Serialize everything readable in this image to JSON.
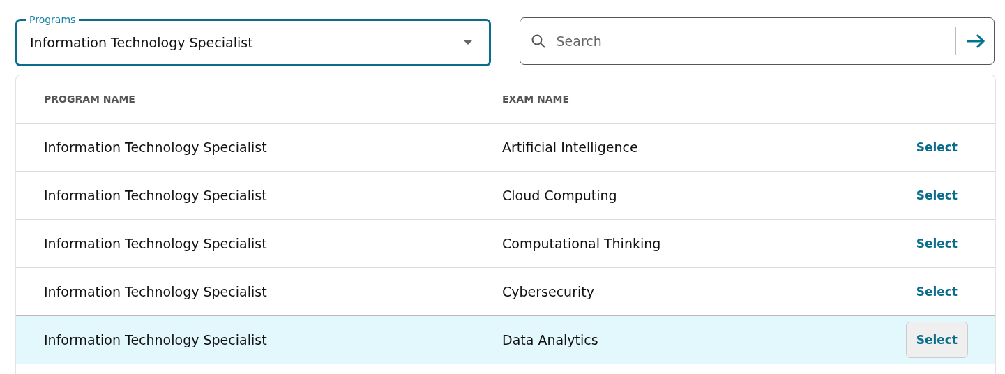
{
  "programs_select": {
    "label": "Programs",
    "value": "Information Technology Specialist"
  },
  "search": {
    "placeholder": "Search"
  },
  "table": {
    "columns": [
      "PROGRAM NAME",
      "EXAM NAME"
    ],
    "rows": [
      {
        "program": "Information Technology Specialist",
        "exam": "Artificial Intelligence",
        "action": "Select",
        "highlighted": false
      },
      {
        "program": "Information Technology Specialist",
        "exam": "Cloud Computing",
        "action": "Select",
        "highlighted": false
      },
      {
        "program": "Information Technology Specialist",
        "exam": "Computational Thinking",
        "action": "Select",
        "highlighted": false
      },
      {
        "program": "Information Technology Specialist",
        "exam": "Cybersecurity",
        "action": "Select",
        "highlighted": false
      },
      {
        "program": "Information Technology Specialist",
        "exam": "Data Analytics",
        "action": "Select",
        "highlighted": true
      }
    ]
  }
}
